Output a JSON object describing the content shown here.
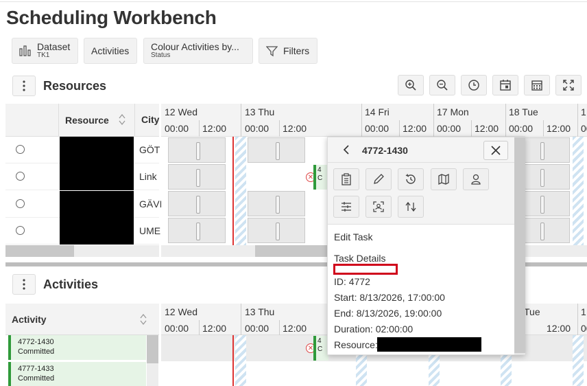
{
  "page": {
    "title": "Scheduling Workbench"
  },
  "toolbar": {
    "dataset_label": "Dataset",
    "dataset_value": "TK1",
    "activities_label": "Activities",
    "colour_label": "Colour Activities by...",
    "colour_value": "Status",
    "filters_label": "Filters"
  },
  "resources": {
    "title": "Resources",
    "col_resource": "Resource",
    "col_city": "City",
    "rows": [
      {
        "city": "GÖT"
      },
      {
        "city": "Link"
      },
      {
        "city": "GÄVI"
      },
      {
        "city": "UME"
      }
    ]
  },
  "timeline": {
    "days": [
      "12 Wed",
      "13 Thu",
      "14 Fri",
      "17 Mon",
      "18 Tue",
      "1"
    ],
    "times": [
      "00:00",
      "12:00"
    ],
    "act_days": [
      "12 Wed",
      "13 Thu",
      "Tue",
      "1"
    ]
  },
  "activities": {
    "title": "Activities",
    "col_activity": "Activity",
    "rows": [
      {
        "id": "4772-1430",
        "status": "Committed"
      },
      {
        "id": "4777-1433",
        "status": "Committed"
      }
    ],
    "chip_text": "4",
    "chip_text2": "C"
  },
  "popup": {
    "title": "4772-1430",
    "edit": "Edit Task",
    "details": "Task Details",
    "id_line": "ID: 4772",
    "start_line": "Start: 8/13/2026, 17:00:00",
    "end_line": "End: 8/13/2026, 19:00:00",
    "duration_line": "Duration: 02:00:00",
    "resource_label": "Resource:"
  },
  "colors": {
    "accent_green": "#2f9a3a",
    "now_line": "#d33",
    "highlight": "#d0021b"
  }
}
